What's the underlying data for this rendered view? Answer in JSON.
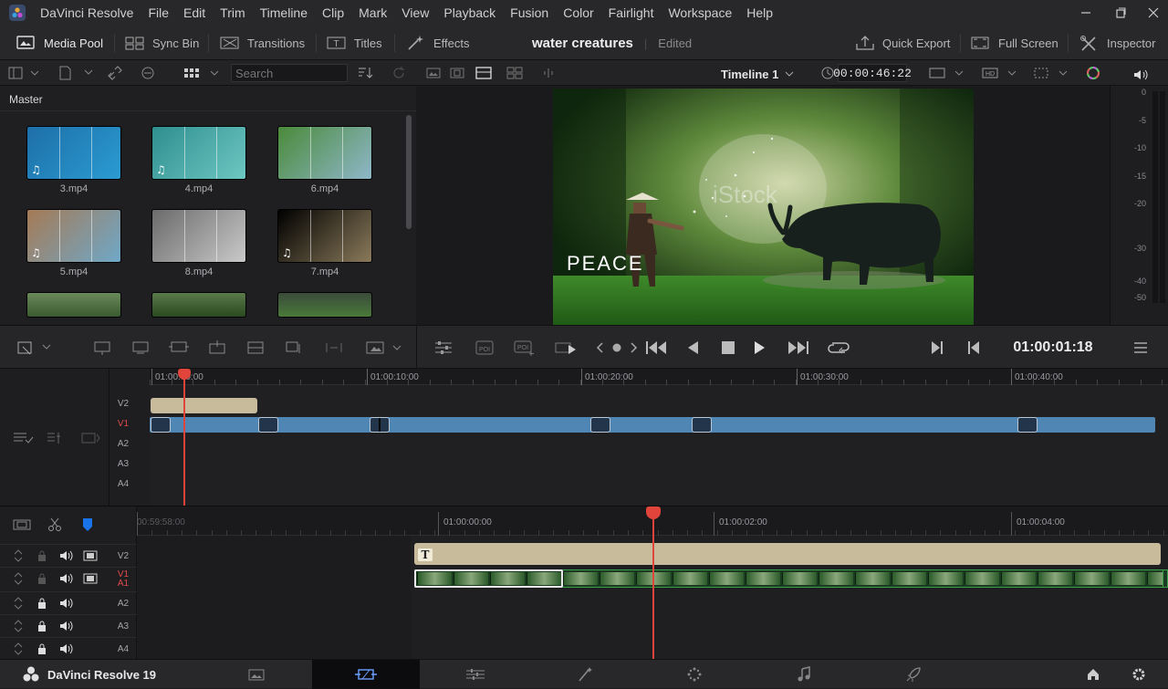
{
  "app": {
    "title": "DaVinci Resolve",
    "version_label": "DaVinci Resolve 19"
  },
  "menu": [
    "File",
    "Edit",
    "Trim",
    "Timeline",
    "Clip",
    "Mark",
    "View",
    "Playback",
    "Fusion",
    "Color",
    "Fairlight",
    "Workspace",
    "Help"
  ],
  "toolbar": {
    "media_pool": "Media Pool",
    "sync_bin": "Sync Bin",
    "transitions": "Transitions",
    "titles": "Titles",
    "effects": "Effects",
    "project_name": "water creatures",
    "project_status": "Edited",
    "quick_export": "Quick Export",
    "full_screen": "Full Screen",
    "inspector": "Inspector"
  },
  "media_pool": {
    "search_placeholder": "Search",
    "bin_name": "Master",
    "clips": [
      {
        "name": "3.mp4",
        "audio": true,
        "colors": [
          "#1e6fa8",
          "#2a9bd1"
        ]
      },
      {
        "name": "4.mp4",
        "audio": true,
        "colors": [
          "#2f8f8f",
          "#6dc7c2"
        ]
      },
      {
        "name": "6.mp4",
        "audio": false,
        "colors": [
          "#4a8a3a",
          "#8fb7c9"
        ]
      },
      {
        "name": "5.mp4",
        "audio": true,
        "colors": [
          "#a57a55",
          "#6fa8c8"
        ]
      },
      {
        "name": "8.mp4",
        "audio": false,
        "colors": [
          "#6b6b6b",
          "#c9c9c9"
        ]
      },
      {
        "name": "7.mp4",
        "audio": true,
        "colors": [
          "#000000",
          "#8a7a5a"
        ]
      }
    ]
  },
  "viewer": {
    "timeline_name": "Timeline 1",
    "duration": "00:00:46:22",
    "overlay_title": "PEACE",
    "watermark": "iStock",
    "timecode": "01:00:01:18"
  },
  "audio_meter": {
    "scale": [
      "0",
      "-5",
      "-10",
      "-15",
      "-20",
      "-30",
      "-40",
      "-50"
    ]
  },
  "upper_timeline": {
    "ruler": [
      "01:00:00:00",
      "01:00:10:00",
      "01:00:20:00",
      "01:00:30:00",
      "01:00:40:00"
    ],
    "tracks": [
      "V2",
      "V1",
      "A2",
      "A3",
      "A4"
    ],
    "active_track": "V1"
  },
  "lower_timeline": {
    "ruler": [
      "00:59:58:00",
      "01:00:00:00",
      "01:00:02:00",
      "01:00:04:00"
    ],
    "tracks": [
      {
        "label": "V2"
      },
      {
        "label": "V1",
        "label2": "A1"
      },
      {
        "label": "A2"
      },
      {
        "label": "A3"
      },
      {
        "label": "A4"
      }
    ],
    "title_clip_icon": "T"
  },
  "pages": [
    "media-page",
    "cut-page",
    "edit-page",
    "fusion-page",
    "color-page",
    "fairlight-page",
    "deliver-page"
  ],
  "active_page": "edit-page",
  "colors": {
    "accent_red": "#e0443a",
    "clip_blue": "#4f86b3",
    "title_tan": "#c8bb9c",
    "active_track_red": "#e24b4b"
  }
}
